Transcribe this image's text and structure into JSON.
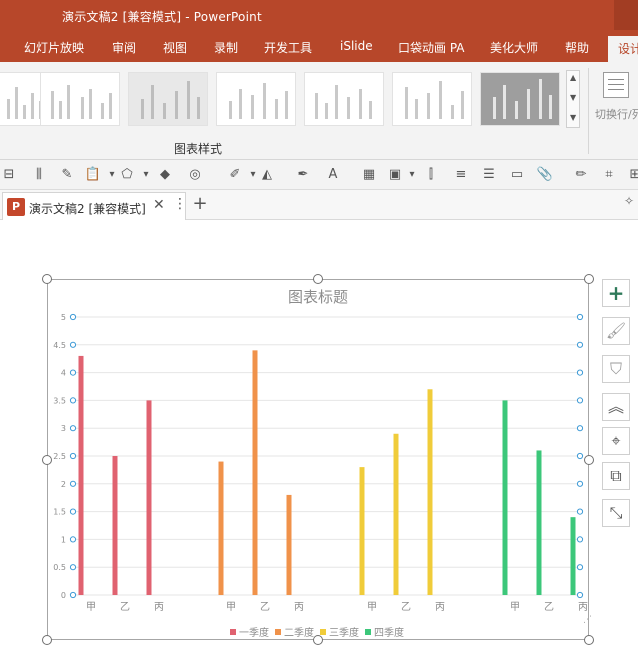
{
  "window": {
    "title": "演示文稿2 [兼容模式] - PowerPoint"
  },
  "ribbon_tabs": [
    {
      "label": "幻灯片放映"
    },
    {
      "label": "审阅"
    },
    {
      "label": "视图"
    },
    {
      "label": "录制"
    },
    {
      "label": "开发工具"
    },
    {
      "label": "iSlide"
    },
    {
      "label": "口袋动画 PA"
    },
    {
      "label": "美化大师"
    },
    {
      "label": "帮助"
    },
    {
      "label": "设计"
    }
  ],
  "ribbon": {
    "group_label": "图表样式",
    "switch_rowcol_label": "切换行/列"
  },
  "document_tab": {
    "name": "演示文稿2 [兼容模式]",
    "app_badge": "P"
  },
  "chart_data": {
    "type": "bar",
    "title": "图表标题",
    "groups": [
      {
        "series": "一季度",
        "categories": [
          "甲",
          "乙",
          "丙"
        ],
        "values": [
          4.3,
          2.5,
          3.5
        ]
      },
      {
        "series": "二季度",
        "categories": [
          "甲",
          "乙",
          "丙"
        ],
        "values": [
          2.4,
          4.4,
          1.8
        ]
      },
      {
        "series": "三季度",
        "categories": [
          "甲",
          "乙",
          "丙"
        ],
        "values": [
          2.3,
          2.9,
          3.7
        ]
      },
      {
        "series": "四季度",
        "categories": [
          "甲",
          "乙",
          "丙"
        ],
        "values": [
          3.5,
          2.6,
          1.4
        ]
      }
    ],
    "series": [
      {
        "name": "一季度",
        "color": "#e06270"
      },
      {
        "name": "二季度",
        "color": "#f0924a"
      },
      {
        "name": "三季度",
        "color": "#f0cc3a"
      },
      {
        "name": "四季度",
        "color": "#3cc77a"
      }
    ],
    "ylim": [
      0,
      5
    ],
    "yticks": [
      "0",
      "0.5",
      "1",
      "1.5",
      "2",
      "2.5",
      "3",
      "3.5",
      "4",
      "4.5",
      "5"
    ],
    "grid": true,
    "legend_position": "bottom"
  }
}
